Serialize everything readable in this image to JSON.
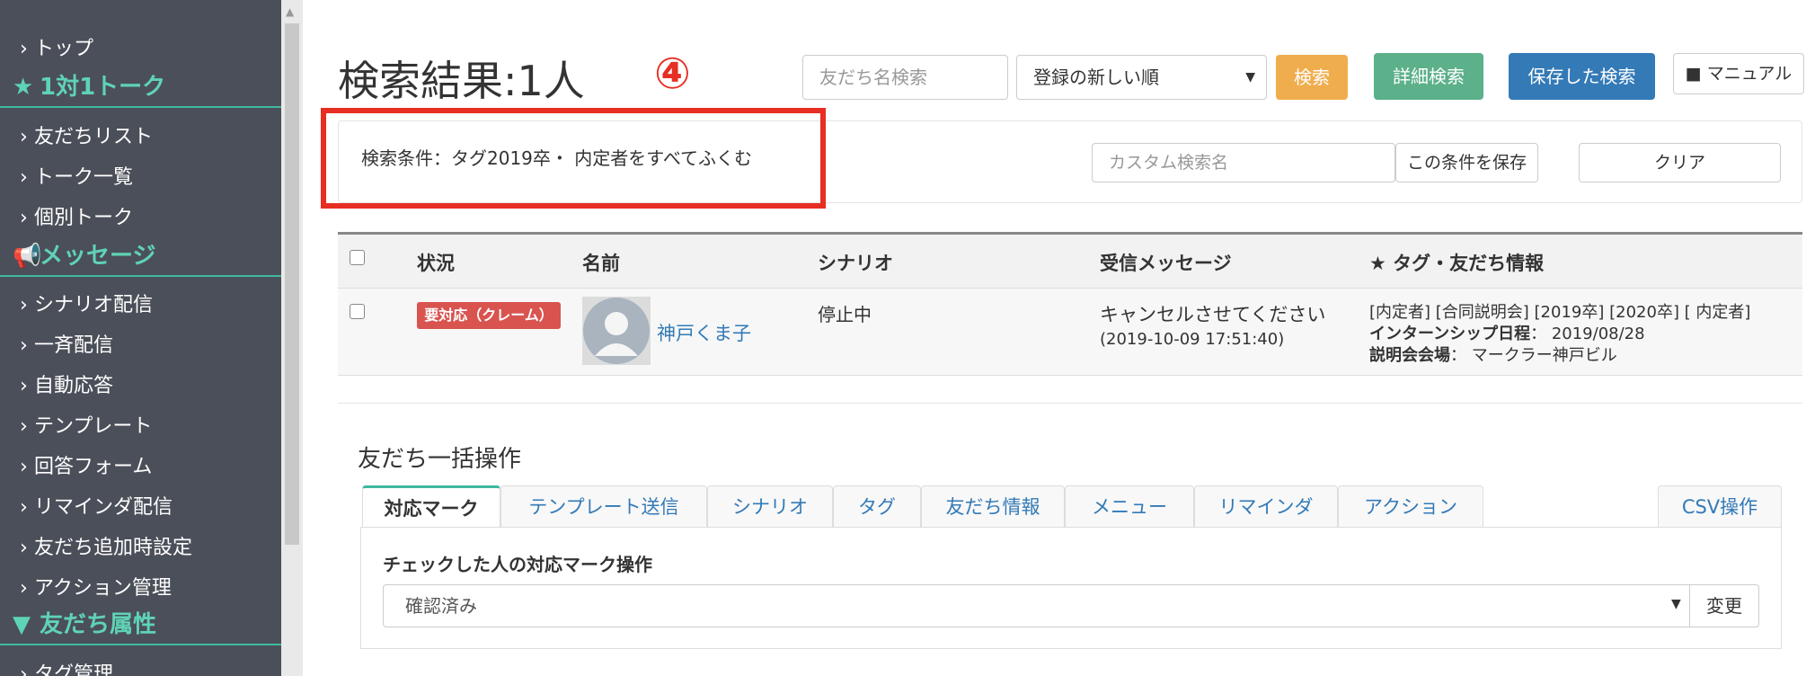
{
  "sidebar": {
    "items": [
      {
        "label": "トップ",
        "type": "item"
      },
      {
        "label": "1対1トーク",
        "type": "section",
        "icon": "star-icon"
      },
      {
        "label": "友だちリスト",
        "type": "item"
      },
      {
        "label": "トーク一覧",
        "type": "item"
      },
      {
        "label": "個別トーク",
        "type": "item"
      },
      {
        "label": "メッセージ",
        "type": "section",
        "icon": "megaphone-icon"
      },
      {
        "label": "シナリオ配信",
        "type": "item"
      },
      {
        "label": "一斉配信",
        "type": "item"
      },
      {
        "label": "自動応答",
        "type": "item"
      },
      {
        "label": "テンプレート",
        "type": "item"
      },
      {
        "label": "回答フォーム",
        "type": "item"
      },
      {
        "label": "リマインダ配信",
        "type": "item"
      },
      {
        "label": "友だち追加時設定",
        "type": "item"
      },
      {
        "label": "アクション管理",
        "type": "item"
      },
      {
        "label": "友だち属性",
        "type": "section",
        "icon": "filter-icon"
      },
      {
        "label": "タグ管理",
        "type": "item"
      }
    ]
  },
  "header": {
    "title": "検索結果:1人",
    "annotation": "④",
    "search_placeholder": "友だち名検索",
    "sort_value": "登録の新しい順",
    "search_button": "検索",
    "advanced_button": "詳細検索",
    "saved_button": "保存した検索",
    "manual_button": "マニュアル"
  },
  "conditions": {
    "text": "検索条件：タグ2019卒・ 内定者をすべてふくむ",
    "custom_name_placeholder": "カスタム検索名",
    "save_button": "この条件を保存",
    "clear_button": "クリア"
  },
  "table": {
    "columns": [
      "状況",
      "名前",
      "シナリオ",
      "受信メッセージ",
      "★ タグ・友だち情報"
    ],
    "rows": [
      {
        "status_badge": "要対応（クレーム）",
        "name": "神戸くま子",
        "scenario": "停止中",
        "message": "キャンセルさせてください",
        "message_time": "(2019-10-09 17:51:40)",
        "tags": "[内定者] [合同説明会] [2019卒] [2020卒] [ 内定者]",
        "info1_label": "インターンシップ日程",
        "info1_value": "： 2019/08/28",
        "info2_label": "説明会会場",
        "info2_value": "： マークラー神戸ビル"
      }
    ]
  },
  "bulk": {
    "title": "友だち一括操作",
    "tabs": [
      "対応マーク",
      "テンプレート送信",
      "シナリオ",
      "タグ",
      "友だち情報",
      "メニュー",
      "リマインダ",
      "アクション",
      "CSV操作"
    ],
    "active_tab": "対応マーク",
    "op_label": "チェックした人の対応マーク操作",
    "op_value": "確認済み",
    "change_button": "変更"
  },
  "colors": {
    "sidebar_bg": "#4b4f59",
    "accent": "#3fb8a0",
    "search_btn": "#f0ad4e",
    "advanced_btn": "#5cb08a",
    "saved_btn": "#337ab7",
    "annotation_red": "#e62e22",
    "badge_red": "#d9534f"
  }
}
